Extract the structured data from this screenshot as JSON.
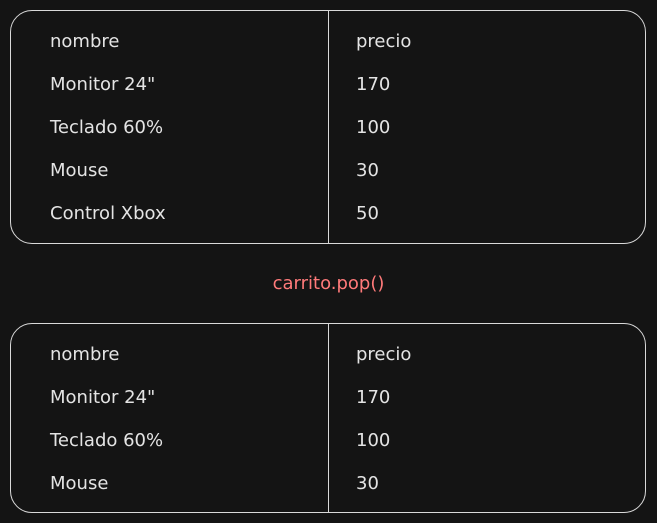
{
  "before": {
    "headers": {
      "name": "nombre",
      "price": "precio"
    },
    "rows": [
      {
        "name": "Monitor 24\"",
        "price": "170"
      },
      {
        "name": "Teclado 60%",
        "price": "100"
      },
      {
        "name": "Mouse",
        "price": "30"
      },
      {
        "name": "Control Xbox",
        "price": "50"
      }
    ]
  },
  "operation": "carrito.pop()",
  "after": {
    "headers": {
      "name": "nombre",
      "price": "precio"
    },
    "rows": [
      {
        "name": "Monitor 24\"",
        "price": "170"
      },
      {
        "name": "Teclado 60%",
        "price": "100"
      },
      {
        "name": "Mouse",
        "price": "30"
      }
    ]
  },
  "colors": {
    "background": "#141414",
    "text": "#e4e4e4",
    "border": "#d9d9d9",
    "operation": "#ff7a7a"
  }
}
